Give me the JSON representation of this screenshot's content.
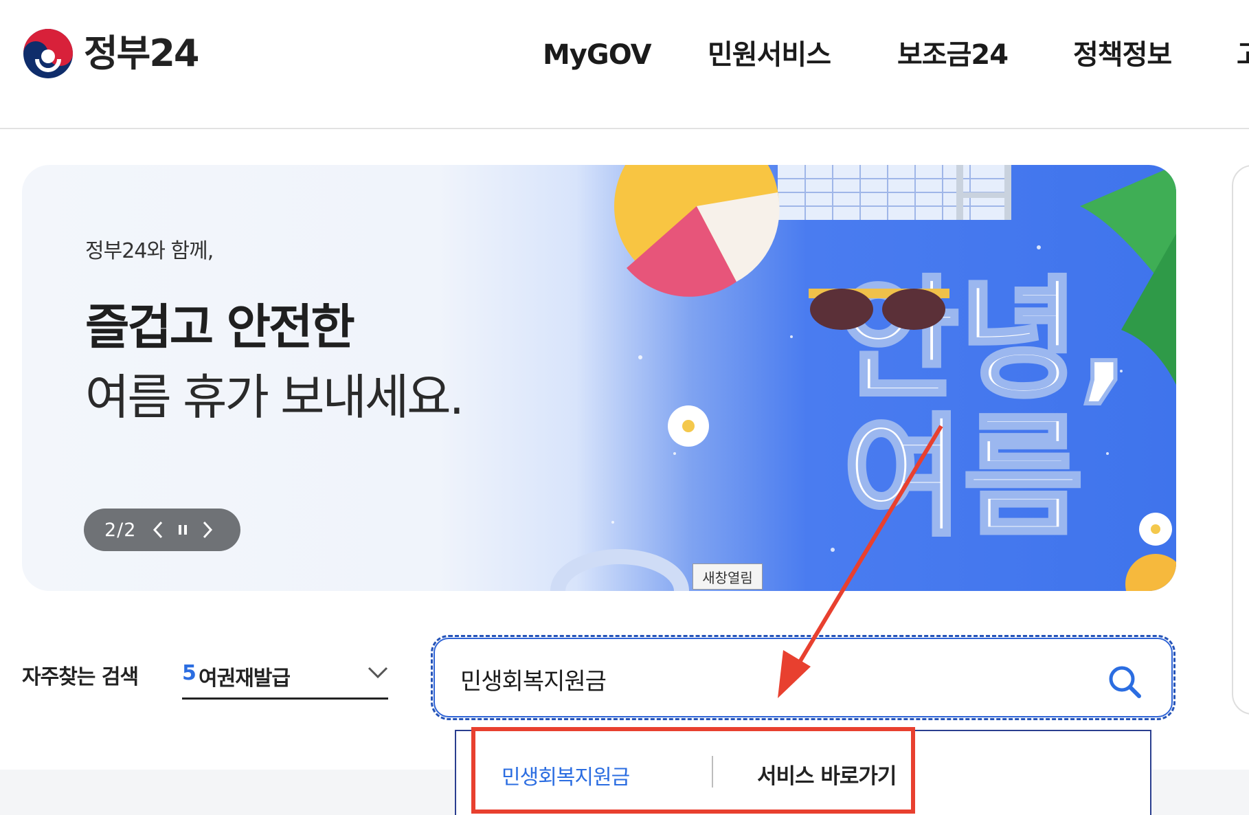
{
  "header": {
    "logo_text": "정부24",
    "nav": [
      {
        "label": "MyGOV"
      },
      {
        "label": "민원서비스"
      },
      {
        "label": "보조금24"
      },
      {
        "label": "정책정보"
      },
      {
        "label": "고"
      }
    ]
  },
  "banner": {
    "subtitle": "정부24와 함께,",
    "title_bold": "즐겁고 안전한",
    "title_light": "여름 휴가 보내세요.",
    "art_text": "안녕, 여름",
    "slide_counter": "2/2",
    "prev_icon": "chevron-left-icon",
    "pause_icon": "pause-icon",
    "next_icon": "chevron-right-icon",
    "tooltip": "새창열림"
  },
  "search": {
    "frequent_label": "자주찾는 검색",
    "frequent_rank": "5",
    "frequent_item": "여권재발급",
    "query": "민생회복지원금",
    "search_icon": "search-icon"
  },
  "suggestion": {
    "keyword": "민생회복지원금",
    "action": "서비스 바로가기"
  },
  "colors": {
    "accent_blue": "#2b6de1",
    "annotation_red": "#e8402f",
    "banner_blue": "#3f74ec"
  }
}
